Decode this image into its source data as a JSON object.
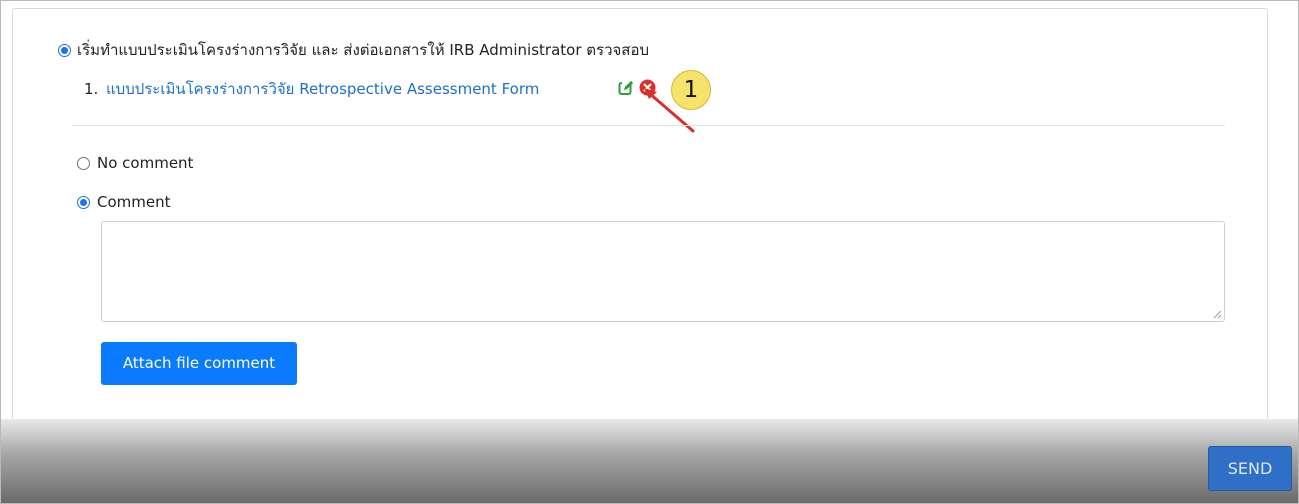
{
  "review": {
    "option_start_label": "เริ่มทำแบบประเมินโครงร่างการวิจัย และ ส่งต่อเอกสารให้ IRB Administrator ตรวจสอบ",
    "form_number": "1.",
    "form_link": "แบบประเมินโครงร่างการวิจัย Retrospective Assessment Form",
    "callout_number": "1"
  },
  "comment_section": {
    "no_comment_label": "No comment",
    "comment_label": "Comment",
    "comment_value": "",
    "attach_button_label": "Attach file comment"
  },
  "footer": {
    "send_label": "SEND"
  },
  "colors": {
    "link": "#1e6fc9",
    "primary_button": "#0a7bff",
    "edit_icon": "#2e9e3a",
    "delete_icon": "#d9302c",
    "callout": "#f7e26b",
    "arrow": "#d9302c"
  },
  "icons": {
    "edit": "edit-icon",
    "delete": "delete-circle-icon"
  }
}
